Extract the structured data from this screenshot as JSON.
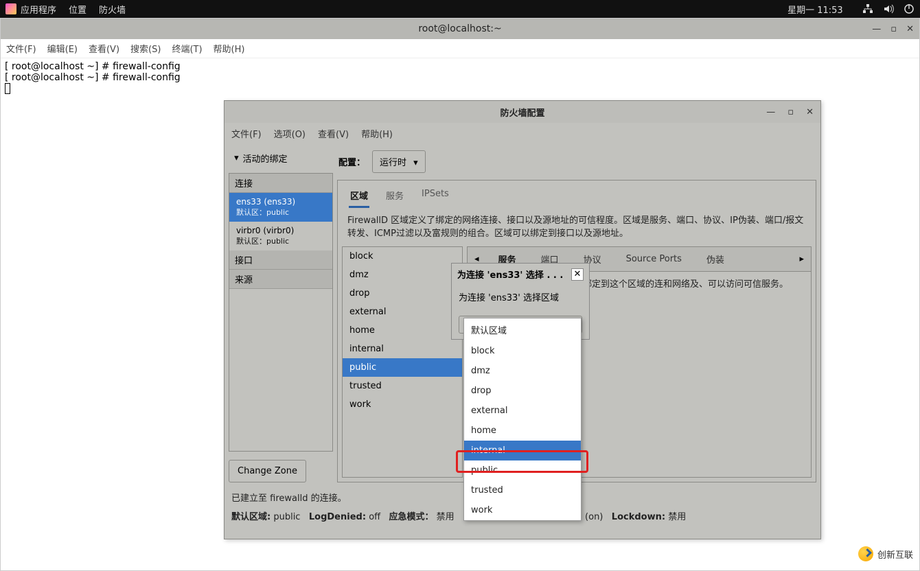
{
  "top_panel": {
    "applications": "应用程序",
    "places": "位置",
    "firewall": "防火墙",
    "clock": "星期一 11:53"
  },
  "terminal": {
    "title": "root@localhost:~",
    "menu": {
      "file": "文件(F)",
      "edit": "编辑(E)",
      "view": "查看(V)",
      "search": "搜索(S)",
      "terminal": "终端(T)",
      "help": "帮助(H)"
    },
    "line1": "[ root@localhost ~] # firewall-config",
    "line2": "[ root@localhost ~] # firewall-config"
  },
  "fw": {
    "title": "防火墙配置",
    "menu": {
      "file": "文件(F)",
      "options": "选项(O)",
      "view": "查看(V)",
      "help": "帮助(H)"
    },
    "left": {
      "header": "活动的绑定",
      "section_connections": "连接",
      "section_interfaces": "接口",
      "section_sources": "来源",
      "conn1": {
        "name": "ens33 (ens33)",
        "sub": "默认区：public"
      },
      "conn2": {
        "name": "virbr0 (virbr0)",
        "sub": "默认区：public"
      },
      "change_zone": "Change Zone"
    },
    "cfg": {
      "label": "配置：",
      "value": "运行时"
    },
    "tabs": {
      "zone": "区域",
      "services": "服务",
      "ipsets": "IPSets"
    },
    "desc": "FirewallD 区域定义了绑定的网络连接、接口以及源地址的可信程度。区域是服务、端口、协议、IP伪装、端口/报文转发、ICMP过滤以及富规则的组合。区域可以绑定到接口以及源地址。",
    "zones": [
      "block",
      "dmz",
      "drop",
      "external",
      "home",
      "internal",
      "public",
      "trusted",
      "work"
    ],
    "zone_selected": "public",
    "zd_tabs": {
      "services": "服务",
      "ports": "端口",
      "protocols": "协议",
      "source_ports": "Source Ports",
      "masq": "伪装"
    },
    "zd_desc": "些服务是可信的。可连接至绑定到这个区域的连和网络及、可以访问可信服务。",
    "status1": "已建立至 firewalld 的连接。",
    "status2": {
      "defzone_l": "默认区域:",
      "defzone_v": "public",
      "logdenied_l": "LogDenied:",
      "logdenied_v": "off",
      "panic_l": "应急模式：",
      "panic_v": "禁用",
      "automatic": "m (on)",
      "lockdown_l": "Lockdown:",
      "lockdown_v": "禁用"
    }
  },
  "dlg": {
    "title": "为连接 'ens33' 选择 . . .",
    "body": "为连接 'ens33' 选择区域",
    "options": [
      "默认区域",
      "block",
      "dmz",
      "drop",
      "external",
      "home",
      "internal",
      "public",
      "trusted",
      "work"
    ],
    "highlighted": "internal"
  },
  "watermark": "创新互联"
}
